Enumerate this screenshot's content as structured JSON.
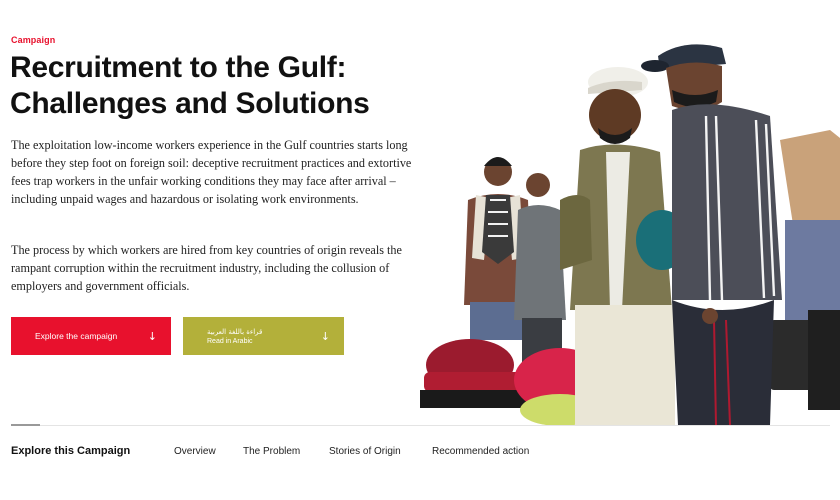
{
  "campaign": {
    "eyebrow": "Campaign",
    "title": "Recruitment to the Gulf: Challenges and Solutions",
    "paragraph_1": "The exploitation low-income workers experience in the Gulf countries starts long before they step foot on foreign soil: deceptive recruitment practices and extortive fees trap workers in the unfair working conditions they may face after arrival – including unpaid wages and hazardous or isolating work environments.",
    "paragraph_2": "The process by which workers are hired from key countries of origin reveals the rampant corruption within the recruitment industry, including the collusion of employers and government officials."
  },
  "buttons": {
    "explore_label": "Explore the campaign",
    "arabic_label": "قراءة باللغة العربية",
    "arabic_sub_label": "Read in Arabic"
  },
  "subnav": {
    "title": "Explore this Campaign",
    "links": [
      "Overview",
      "The Problem",
      "Stories of Origin",
      "Recommended action"
    ]
  },
  "colors": {
    "accent_red": "#e8112d",
    "olive": "#b3b03a"
  },
  "icons": {
    "button_arrow": "arrow-down-icon"
  }
}
